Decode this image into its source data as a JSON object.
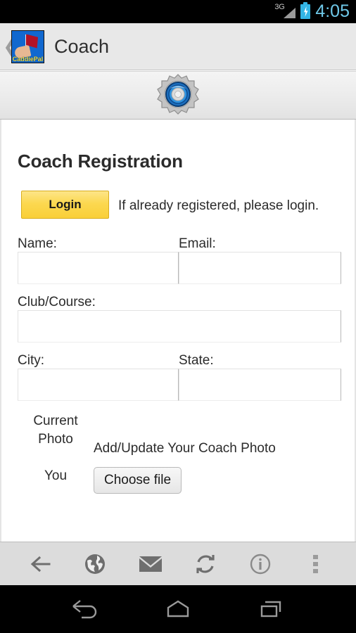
{
  "status_bar": {
    "network_label": "3G",
    "time": "4:05",
    "battery_icon": "battery-charging-icon",
    "signal_icon": "signal-bars-icon"
  },
  "app_bar": {
    "back_icon": "back-chevron-icon",
    "logo_name": "caddiepal-logo",
    "logo_text": "CaddiePal",
    "title": "Coach"
  },
  "banner": {
    "icon": "gear-icon"
  },
  "main": {
    "page_title": "Coach Registration",
    "login_button": "Login",
    "login_note": "If already registered, please login.",
    "fields": {
      "name_label": "Name:",
      "name_value": "",
      "email_label": "Email:",
      "email_value": "",
      "club_label": "Club/Course:",
      "club_value": "",
      "city_label": "City:",
      "city_value": "",
      "state_label": "State:",
      "state_value": ""
    },
    "photo": {
      "current_photo_label": "Current Photo",
      "you_label": "You",
      "add_photo_heading": "Add/Update Your Coach Photo",
      "choose_file_label": "Choose file"
    }
  },
  "toolbar": {
    "items": [
      {
        "name": "back-arrow-icon",
        "label": "Back"
      },
      {
        "name": "globe-icon",
        "label": "Browser"
      },
      {
        "name": "mail-icon",
        "label": "Mail"
      },
      {
        "name": "refresh-icon",
        "label": "Refresh"
      },
      {
        "name": "info-icon",
        "label": "Info"
      },
      {
        "name": "overflow-menu-icon",
        "label": "More"
      }
    ]
  },
  "nav_bar": {
    "back_label": "Back",
    "home_label": "Home",
    "recents_label": "Recent apps"
  },
  "colors": {
    "status_bar_bg": "#000000",
    "app_bar_bg": "#e8e8e8",
    "accent_yellow": "#fcd850",
    "clock_blue": "#6fc8e8",
    "logo_blue": "#1168cf",
    "toolbar_bg": "#dcdcdc"
  }
}
